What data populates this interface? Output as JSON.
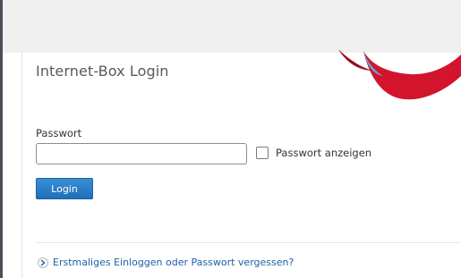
{
  "page": {
    "title": "Internet-Box Login"
  },
  "form": {
    "password_label": "Passwort",
    "password_value": "",
    "show_password_label": "Passwort anzeigen",
    "show_password_checked": false,
    "login_label": "Login"
  },
  "help": {
    "link_text": "Erstmaliges Einloggen oder Passwort vergessen?"
  },
  "colors": {
    "accent_blue": "#1f6fb8",
    "brand_red": "#d2142c",
    "link_blue": "#1f5fa8"
  },
  "icons": {
    "help": "chevron-right-icon"
  }
}
